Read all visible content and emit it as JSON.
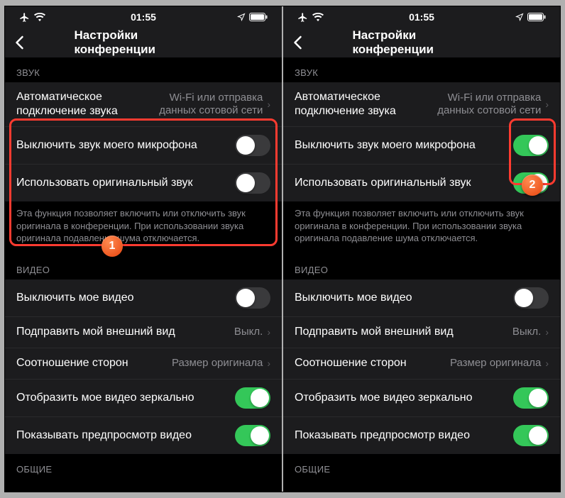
{
  "status": {
    "time": "01:55"
  },
  "nav": {
    "title": "Настройки конференции"
  },
  "sections": {
    "sound_header": "ЗВУК",
    "video_header": "ВИДЕО",
    "general_header": "ОБЩИЕ"
  },
  "rows": {
    "auto_audio": {
      "label": "Автоматическое подключение звука",
      "value": "Wi-Fi или отправка данных сотовой сети"
    },
    "mute_mic": {
      "label": "Выключить звук моего микрофона"
    },
    "original_sound": {
      "label": "Использовать оригинальный звук"
    },
    "original_sound_desc": "Эта функция позволяет включить или отключить звук оригинала в конференции. При использовании звука оригинала подавление шума отключается.",
    "video_off": {
      "label": "Выключить мое видео"
    },
    "touch_up": {
      "label": "Подправить мой внешний вид",
      "value": "Выкл."
    },
    "aspect": {
      "label": "Соотношение сторон",
      "value": "Размер оригинала"
    },
    "mirror": {
      "label": "Отобразить мое видео зеркально"
    },
    "preview": {
      "label": "Показывать предпросмотр видео"
    }
  },
  "badges": {
    "b1": "1",
    "b2": "2"
  }
}
